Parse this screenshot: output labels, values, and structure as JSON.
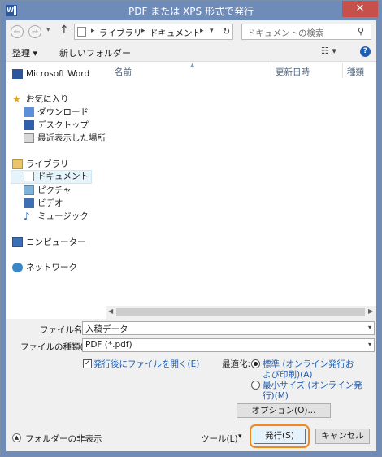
{
  "window": {
    "title": "PDF または XPS 形式で発行",
    "close_glyph": "✕"
  },
  "address": {
    "crumbs": [
      "ライブラリ",
      "ドキュメント"
    ],
    "search_placeholder": "ドキュメントの検索"
  },
  "toolbar": {
    "organize": "整理 ▾",
    "new_folder": "新しいフォルダー"
  },
  "nav": {
    "word": "Microsoft Word",
    "favorites": "お気に入り",
    "fav_items": [
      "ダウンロード",
      "デスクトップ",
      "最近表示した場所"
    ],
    "libraries": "ライブラリ",
    "lib_items": [
      "ドキュメント",
      "ピクチャ",
      "ビデオ",
      "ミュージック"
    ],
    "computer": "コンピューター",
    "network": "ネットワーク"
  },
  "columns": [
    "名前",
    "更新日時",
    "種類"
  ],
  "form": {
    "filename_label": "ファイル名(N):",
    "filename_value": "入稿データ",
    "filetype_label": "ファイルの種類(T):",
    "filetype_value": "PDF (*.pdf)",
    "open_after": "発行後にファイルを開く(E)",
    "optimize_label": "最適化:",
    "opt_standard_1": "標準 (オンライン発行お",
    "opt_standard_2": "よび印刷)(A)",
    "opt_min_1": "最小サイズ (オンライン発",
    "opt_min_2": "行)(M)",
    "options_button": "オプション(O)..."
  },
  "bottom": {
    "hide_folders": "フォルダーの非表示",
    "tools": "ツール(L)",
    "publish": "発行(S)",
    "cancel": "キャンセル"
  },
  "colors": {
    "title_bar": "#6f8bb8",
    "close_button": "#c7504a",
    "highlight": "#f08a1e",
    "link": "#1e5fb4"
  },
  "icons": [
    "word-icon",
    "back-icon",
    "forward-icon",
    "up-arrow-icon",
    "folder-icon",
    "refresh-icon",
    "search-icon",
    "view-icon",
    "help-icon",
    "star-icon",
    "download-icon",
    "desktop-icon",
    "recent-icon",
    "library-icon",
    "document-icon",
    "picture-icon",
    "video-icon",
    "music-icon",
    "computer-icon",
    "network-icon",
    "chevron-up-icon"
  ]
}
